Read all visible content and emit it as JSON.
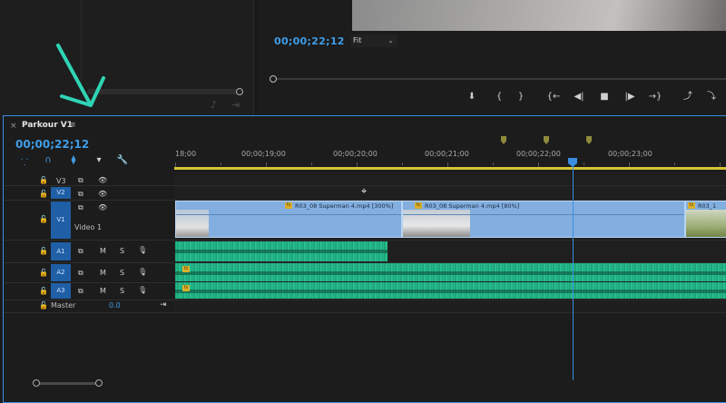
{
  "top": {
    "source_icons": [
      "♪",
      "⇥"
    ]
  },
  "program": {
    "timecode": "00;00;22;12",
    "fit_label": "Fit",
    "controls": [
      "⬇",
      "{",
      "}",
      "{←",
      "◀|",
      "■",
      "|▶",
      "→}",
      "⤴",
      "⤵"
    ]
  },
  "timeline": {
    "close": "×",
    "sequence_name": "Parkour V1",
    "menu": "≡",
    "timecode": "00;00;22;12",
    "ruler_labels": [
      "18;00",
      "00;00;19;00",
      "00;00;20;00",
      "00;00;21;00",
      "00;00;22;00",
      "00;00;23;00"
    ],
    "tools": [
      "⸪",
      "∩",
      "⧫",
      "▾",
      "🔧"
    ],
    "tracks": {
      "V3": "V3",
      "V2": "V2",
      "V1": "V1",
      "video1_name": "Video 1",
      "A1": "A1",
      "A2": "A2",
      "A3": "A3",
      "master_name": "Master",
      "master_value": "0.0",
      "mute": "M",
      "solo": "S"
    },
    "clips": {
      "clip1_title": "R03_08 Superman 4.mp4 [300%]",
      "clip2_title": "R03_08 Superman 4.mp4 [80%]",
      "clip3_title": "R03_1",
      "fx": "fx"
    }
  },
  "colors": {
    "accent": "#3a8de0",
    "video_clip": "#82aee0",
    "audio_clip": "#25c38f",
    "workarea": "#d5c537",
    "annotation_arrow": "#2fd4b4"
  }
}
